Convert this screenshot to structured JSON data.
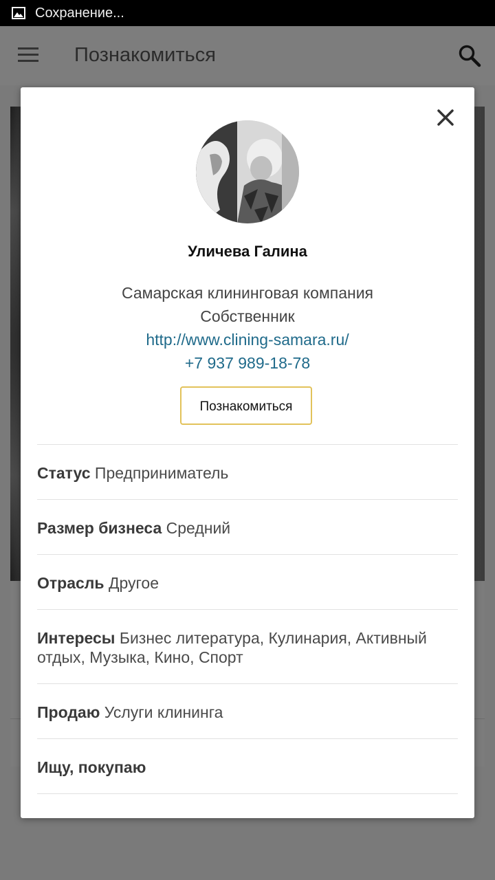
{
  "status_bar": {
    "text": "Сохранение..."
  },
  "app_bar": {
    "title": "Познакомиться"
  },
  "profile": {
    "name": "Уличева Галина",
    "company": "Самарская клининговая компания",
    "role": "Собственник",
    "website": "http://www.clining-samara.ru/",
    "phone": "+7 937 989-18-78",
    "meet_button": "Познакомиться"
  },
  "fields": [
    {
      "label": "Статус",
      "value": "Предприниматель"
    },
    {
      "label": "Размер бизнеса",
      "value": "Средний"
    },
    {
      "label": "Отрасль",
      "value": "Другое"
    },
    {
      "label": "Интересы",
      "value": "Бизнес литература, Кулинария, Активный отдых, Музыка, Кино, Спорт"
    },
    {
      "label": "Продаю",
      "value": "Услуги клининга"
    },
    {
      "label": "Ищу, покупаю",
      "value": ""
    }
  ],
  "colors": {
    "link": "#1f6a8a",
    "button_border": "#e2c25a",
    "overlay": "#7a7a7a"
  }
}
